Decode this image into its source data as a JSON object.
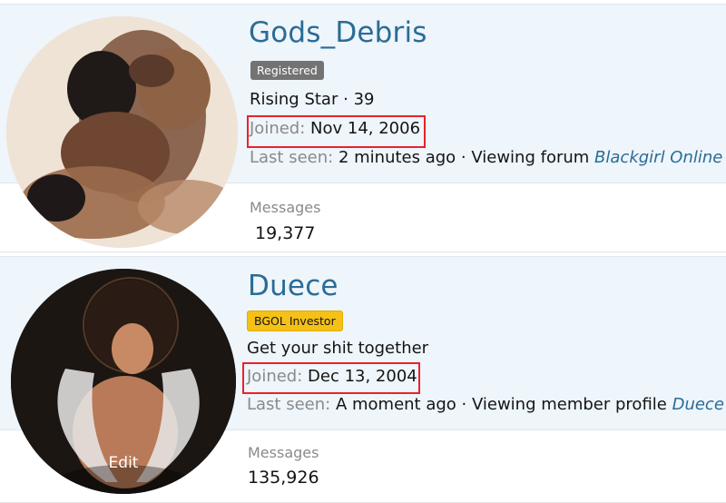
{
  "members": [
    {
      "username": "Gods_Debris",
      "badge": "Registered",
      "title": "Rising Star",
      "separator": "·",
      "reaction_count": "39",
      "joined_label": "Joined:",
      "joined_date": "Nov 14, 2006",
      "last_seen_label": "Last seen:",
      "last_seen_value": "2 minutes ago · Viewing forum",
      "last_seen_link": "Blackgirl Online",
      "messages_label": "Messages",
      "messages_count": "19,377"
    },
    {
      "username": "Duece",
      "badge": "BGOL Investor",
      "title": "Get your shit together",
      "joined_label": "Joined:",
      "joined_date": "Dec 13, 2004",
      "last_seen_label": "Last seen:",
      "last_seen_value": "A moment ago · Viewing member profile",
      "last_seen_link": "Duece",
      "messages_label": "Messages",
      "messages_count": "135,926",
      "avatar_edit_label": "Edit"
    }
  ],
  "colors": {
    "username": "#2a6c96",
    "highlight_box": "#e8232a",
    "badge_registered": "#737373",
    "badge_investor": "#f5c117"
  }
}
